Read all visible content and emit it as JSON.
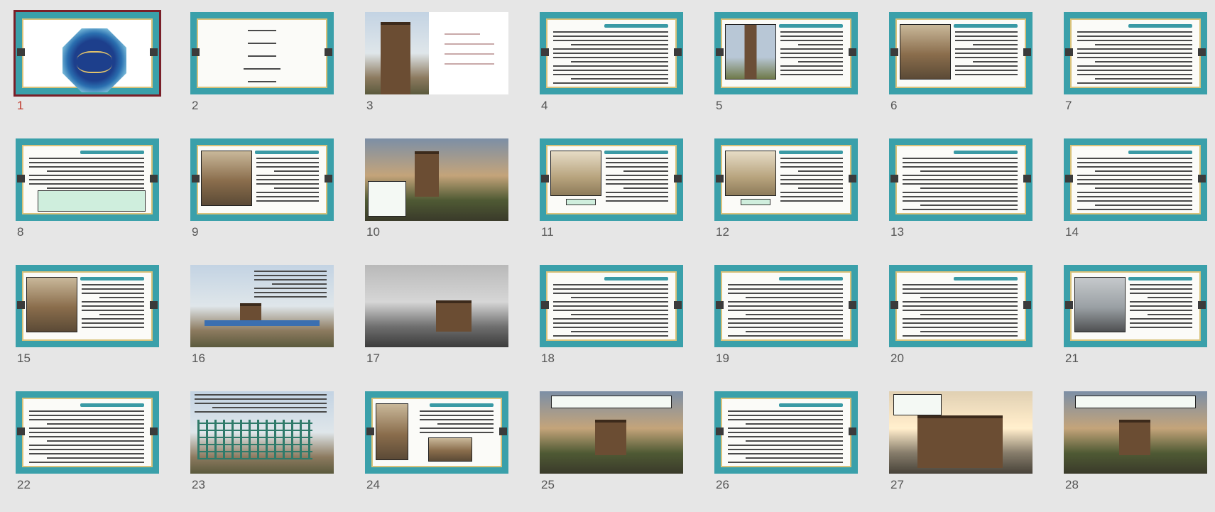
{
  "slide_sorter": {
    "selected_slide": 1,
    "slides": [
      {
        "number": "1"
      },
      {
        "number": "2"
      },
      {
        "number": "3"
      },
      {
        "number": "4"
      },
      {
        "number": "5"
      },
      {
        "number": "6"
      },
      {
        "number": "7"
      },
      {
        "number": "8"
      },
      {
        "number": "9"
      },
      {
        "number": "10"
      },
      {
        "number": "11"
      },
      {
        "number": "12"
      },
      {
        "number": "13"
      },
      {
        "number": "14"
      },
      {
        "number": "15"
      },
      {
        "number": "16"
      },
      {
        "number": "17"
      },
      {
        "number": "18"
      },
      {
        "number": "19"
      },
      {
        "number": "20"
      },
      {
        "number": "21"
      },
      {
        "number": "22"
      },
      {
        "number": "23"
      },
      {
        "number": "24"
      },
      {
        "number": "25"
      },
      {
        "number": "26"
      },
      {
        "number": "27"
      },
      {
        "number": "28"
      }
    ]
  },
  "colors": {
    "background": "#e6e6e6",
    "teal_frame": "#3aa0aa",
    "selection": "#7a1f28",
    "selected_number": "#c0392b"
  }
}
